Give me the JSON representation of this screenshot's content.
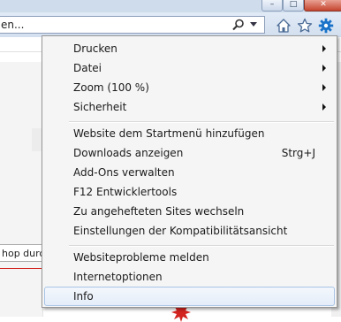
{
  "window": {
    "minimize_glyph": "–",
    "maximize_glyph": "□",
    "close_glyph": "✕"
  },
  "address_bar": {
    "text": "en...",
    "search_icon": "magnifier-icon",
    "dropdown_icon": "chevron-down-icon"
  },
  "toolbar": {
    "home_icon": "home-icon",
    "favorites_icon": "star-icon",
    "tools_icon": "gear-icon",
    "accent_color": "#1a73c9"
  },
  "page": {
    "search_box_text": "hop durch",
    "accent_orange": "#ef7a22",
    "accent_red": "#d2231f"
  },
  "menu": {
    "items": [
      {
        "label": "Drucken",
        "submenu": true
      },
      {
        "label": "Datei",
        "submenu": true
      },
      {
        "label": "Zoom (100 %)",
        "submenu": true
      },
      {
        "label": "Sicherheit",
        "submenu": true
      },
      {
        "label": "Website dem Startmenü hinzufügen"
      },
      {
        "label": "Downloads anzeigen",
        "shortcut": "Strg+J"
      },
      {
        "label": "Add-Ons verwalten"
      },
      {
        "label": "F12 Entwicklertools"
      },
      {
        "label": "Zu angehefteten Sites wechseln"
      },
      {
        "label": "Einstellungen der Kompatibilitätsansicht"
      },
      {
        "label": "Websiteprobleme melden"
      },
      {
        "label": "Internetoptionen"
      },
      {
        "label": "Info",
        "highlighted": true
      }
    ]
  }
}
